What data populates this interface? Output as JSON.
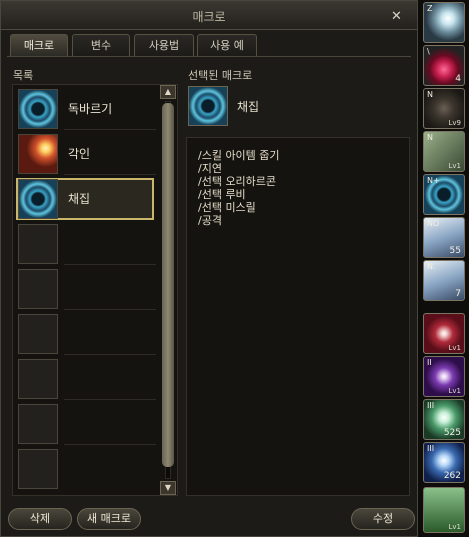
{
  "window": {
    "title": "매크로",
    "close_icon": "close-icon"
  },
  "tabs": [
    {
      "label": "매크로",
      "active": true
    },
    {
      "label": "변수",
      "active": false
    },
    {
      "label": "사용법",
      "active": false
    },
    {
      "label": "사용 예",
      "active": false
    }
  ],
  "list": {
    "header": "목록",
    "items": [
      {
        "name": "독바르기",
        "icon": "swirl-skill-icon"
      },
      {
        "name": "각인",
        "icon": "burst-skill-icon"
      },
      {
        "name": "채집",
        "icon": "gather-skill-icon",
        "selected": true
      }
    ],
    "empty_slots": 6
  },
  "selected": {
    "header": "선택된 매크로",
    "name": "채집",
    "icon": "gather-skill-icon",
    "lines": [
      "/스킬 아이템 줍기",
      "/지연",
      "/선택 오리하르콘",
      "/선택 루비",
      "/선택 미스릴",
      "/공격"
    ]
  },
  "buttons": {
    "delete": "삭제",
    "new_macro": "새 매크로",
    "edit": "수정"
  },
  "quickbar": [
    {
      "icon": "wing-skill-icon",
      "key": "Z",
      "count": "",
      "level": ""
    },
    {
      "icon": "potion-icon",
      "key": "\\",
      "count": "4",
      "level": ""
    },
    {
      "icon": "dark-skill-icon",
      "key": "N",
      "count": "",
      "level": "Lv9"
    },
    {
      "icon": "scroll-skill-icon",
      "key": "N",
      "count": "",
      "level": "Lv1"
    },
    {
      "icon": "gather-skill-icon",
      "key": "N+",
      "count": "",
      "level": ""
    },
    {
      "icon": "scroll-icon",
      "key": "NO",
      "count": "55",
      "level": ""
    },
    {
      "icon": "scroll-icon",
      "key": "N.",
      "count": "7",
      "level": ""
    },
    {
      "icon": "red-eye-icon",
      "key": "",
      "count": "",
      "level": "Lv1"
    },
    {
      "icon": "purple-eye-icon",
      "key": "II",
      "count": "",
      "level": "Lv1"
    },
    {
      "icon": "light-skill-icon",
      "key": "III",
      "count": "525",
      "level": ""
    },
    {
      "icon": "blue-skill-icon",
      "key": "III",
      "count": "262",
      "level": ""
    },
    {
      "icon": "arrow-skill-icon",
      "key": "",
      "count": "",
      "level": "Lv1"
    }
  ]
}
